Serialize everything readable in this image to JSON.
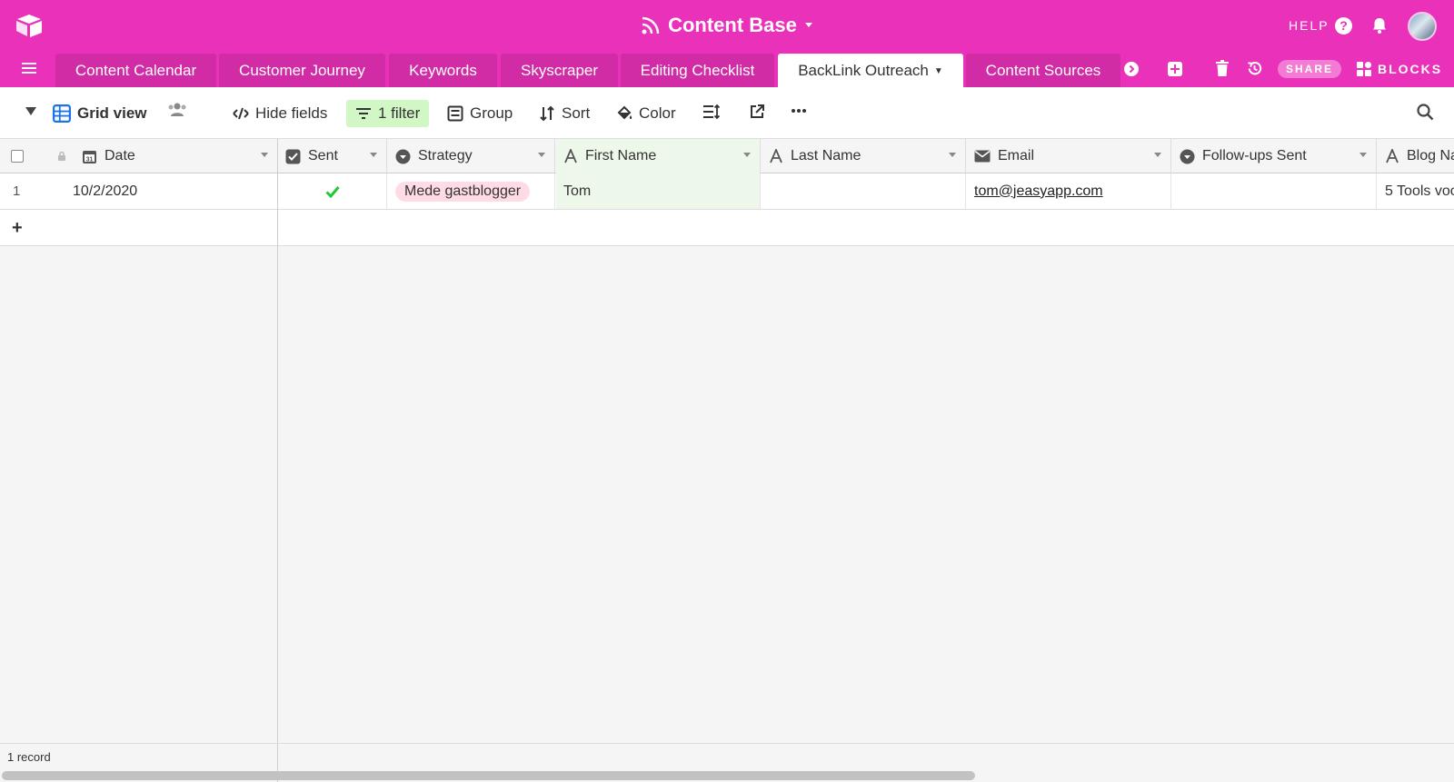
{
  "header": {
    "base_title": "Content Base",
    "help_label": "HELP",
    "help_icon": "?"
  },
  "tabs": [
    {
      "label": "Content Calendar"
    },
    {
      "label": "Customer Journey"
    },
    {
      "label": "Keywords"
    },
    {
      "label": "Skyscraper"
    },
    {
      "label": "Editing Checklist"
    },
    {
      "label": "BackLink Outreach",
      "active": true
    },
    {
      "label": "Content Sources"
    }
  ],
  "tab_actions": {
    "share_label": "SHARE",
    "blocks_label": "BLOCKS"
  },
  "viewbar": {
    "view_name": "Grid view",
    "hide_fields": "Hide fields",
    "filter": "1 filter",
    "group": "Group",
    "sort": "Sort",
    "color": "Color"
  },
  "columns": [
    {
      "label": "Date",
      "icon": "calendar-icon"
    },
    {
      "label": "Sent",
      "icon": "checkbox-icon"
    },
    {
      "label": "Strategy",
      "icon": "single-select-icon"
    },
    {
      "label": "First Name",
      "icon": "text-icon"
    },
    {
      "label": "Last Name",
      "icon": "text-icon"
    },
    {
      "label": "Email",
      "icon": "email-icon"
    },
    {
      "label": "Follow-ups Sent",
      "icon": "single-select-icon"
    },
    {
      "label": "Blog Na",
      "icon": "text-icon"
    }
  ],
  "rows": [
    {
      "number": "1",
      "date": "10/2/2020",
      "sent": true,
      "strategy": "Mede gastblogger",
      "first_name": "Tom",
      "last_name": "",
      "email": "tom@jeasyapp.com",
      "follow_ups": "",
      "blog_name": "5 Tools voo"
    }
  ],
  "footer": {
    "record_count": "1 record"
  },
  "colors": {
    "brand": "#e931b9",
    "tab_inactive": "#d12ca6",
    "filter_bg": "#d1f7c4",
    "pill_bg": "#ffdce5",
    "check": "#20c933"
  }
}
